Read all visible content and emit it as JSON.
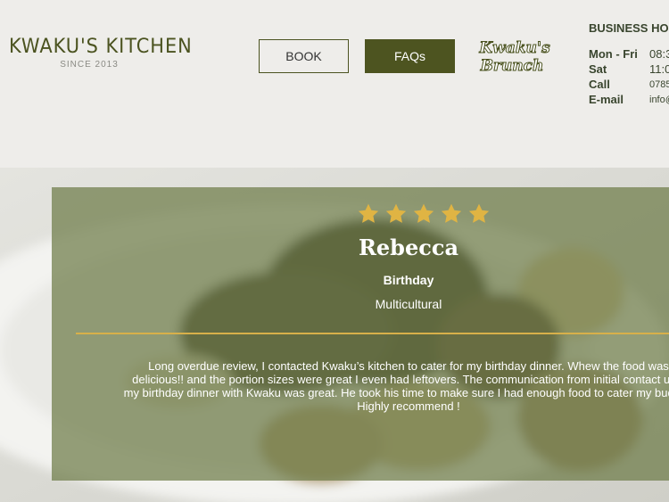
{
  "header": {
    "logo_name": "KWAKU'S KITCHEN",
    "logo_since": "SINCE 2013",
    "book_label": "BOOK",
    "faqs_label": "FAQs",
    "brunch_logo_line1": "Kwaku's",
    "brunch_logo_line2": "Brunch"
  },
  "business_hours": {
    "title": "BUSINESS HOURS",
    "rows": [
      {
        "label": "Mon - Fri",
        "value": "08:3"
      },
      {
        "label": "Sat",
        "value": "11:0"
      },
      {
        "label": "Call",
        "value": "0785"
      },
      {
        "label": "E-mail",
        "value": "info@"
      }
    ]
  },
  "review": {
    "rating": 5,
    "name": "Rebecca",
    "occasion": "Birthday",
    "cuisine": "Multicultural",
    "text": "Long overdue review, I contacted Kwaku’s kitchen to cater for my birthday dinner. Whew the food was delicious!! and the portion sizes were great I even had leftovers. The communication from initial contact until my birthday dinner with Kwaku was great. He took his time to make sure I had enough food to cater my budget. Highly recommend !"
  },
  "colors": {
    "brand_olive": "#4d5420",
    "star_gold": "#e0b443",
    "card_overlay": "#6e7c48",
    "divider_gold": "#d8b04a"
  }
}
